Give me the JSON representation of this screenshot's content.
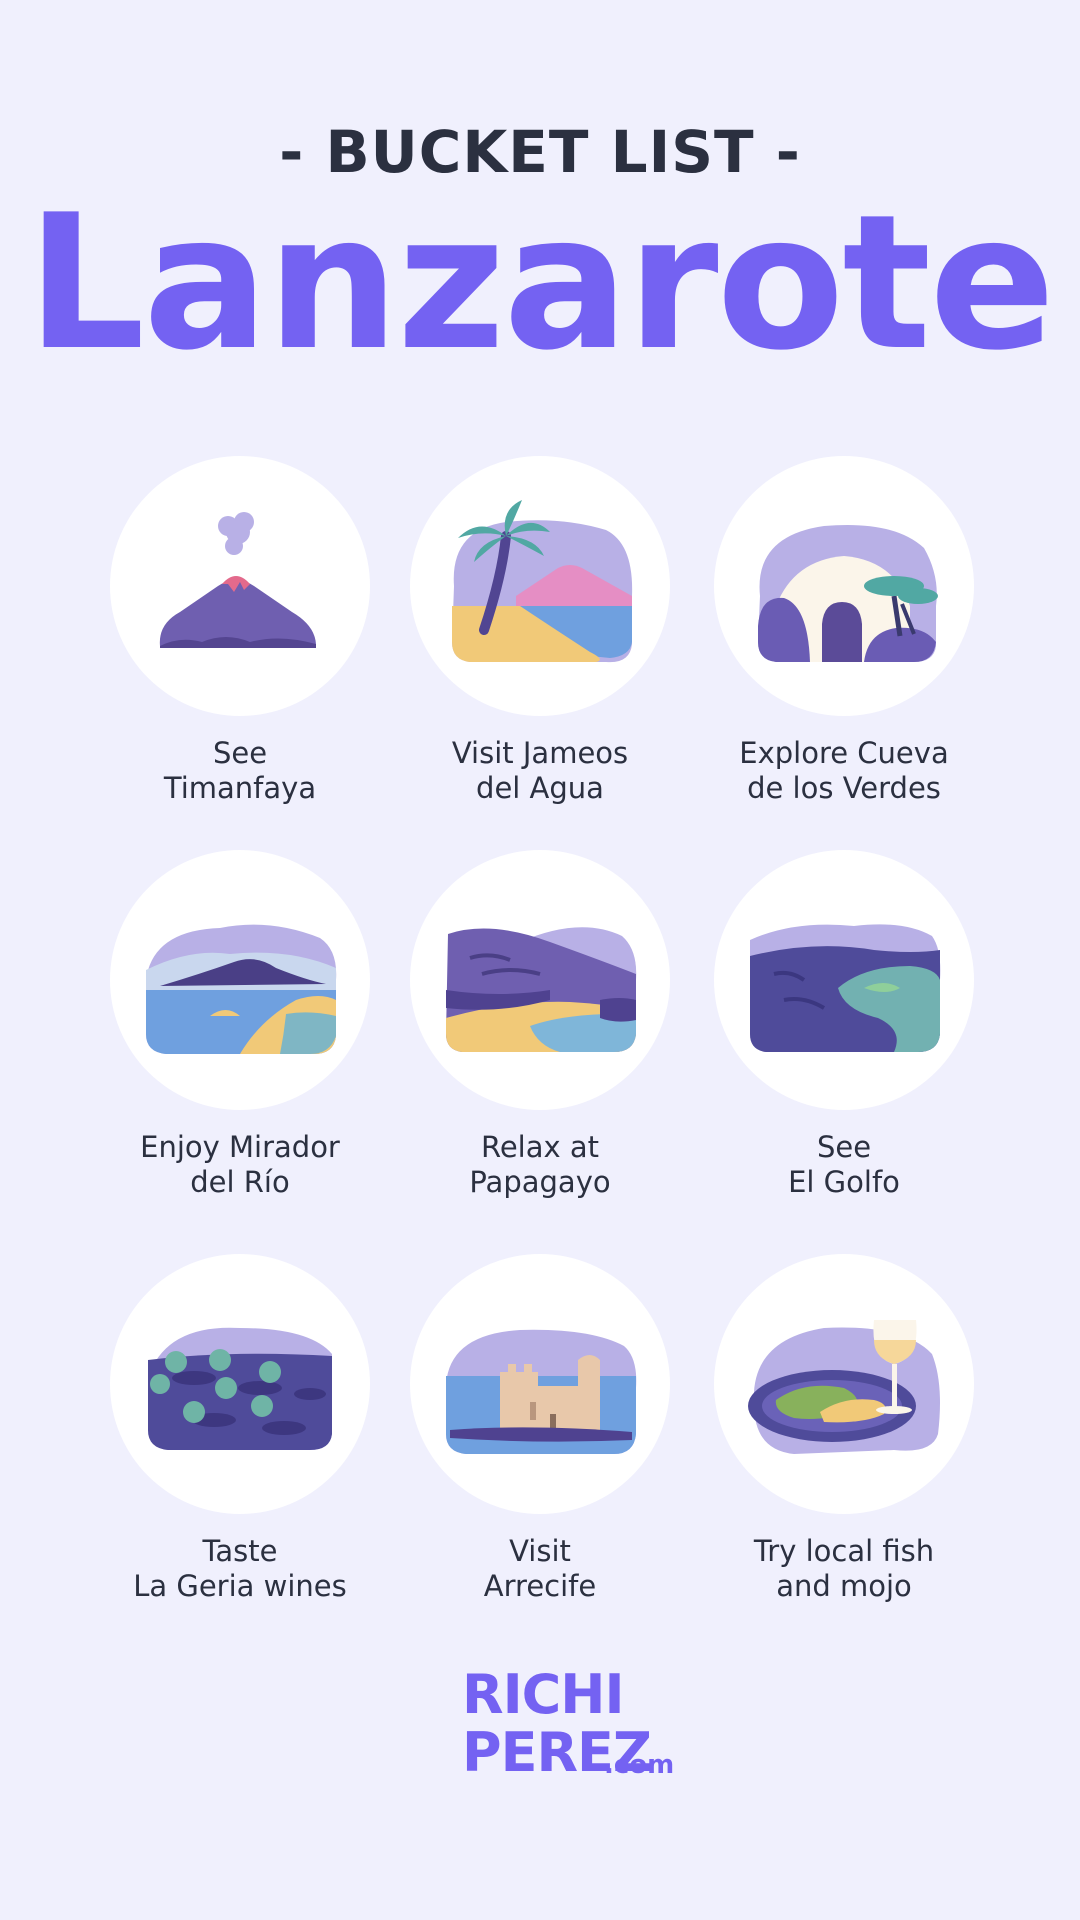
{
  "header": {
    "subtitle": "- BUCKET LIST -",
    "title": "Lanzarote"
  },
  "items": [
    {
      "line1": "See",
      "line2": "Timanfaya",
      "icon": "volcano-icon"
    },
    {
      "line1": "Visit Jameos",
      "line2": "del Agua",
      "icon": "palm-beach-icon"
    },
    {
      "line1": "Explore Cueva",
      "line2": "de los Verdes",
      "icon": "cave-icon"
    },
    {
      "line1": "Enjoy Mirador",
      "line2": "del Río",
      "icon": "viewpoint-icon"
    },
    {
      "line1": "Relax at",
      "line2": "Papagayo",
      "icon": "beach-cliffs-icon"
    },
    {
      "line1": "See",
      "line2": "El Golfo",
      "icon": "green-lagoon-icon"
    },
    {
      "line1": "Taste",
      "line2": "La Geria wines",
      "icon": "vineyard-icon"
    },
    {
      "line1": "Visit",
      "line2": "Arrecife",
      "icon": "castle-icon"
    },
    {
      "line1": "Try local fish",
      "line2": "and mojo",
      "icon": "fish-wine-icon"
    }
  ],
  "logo": {
    "line1": "RICHI",
    "line2": "PEREZ",
    "suffix": ".com"
  },
  "colors": {
    "background": "#f0f0fd",
    "accent": "#7462f2",
    "text": "#2b3040"
  }
}
